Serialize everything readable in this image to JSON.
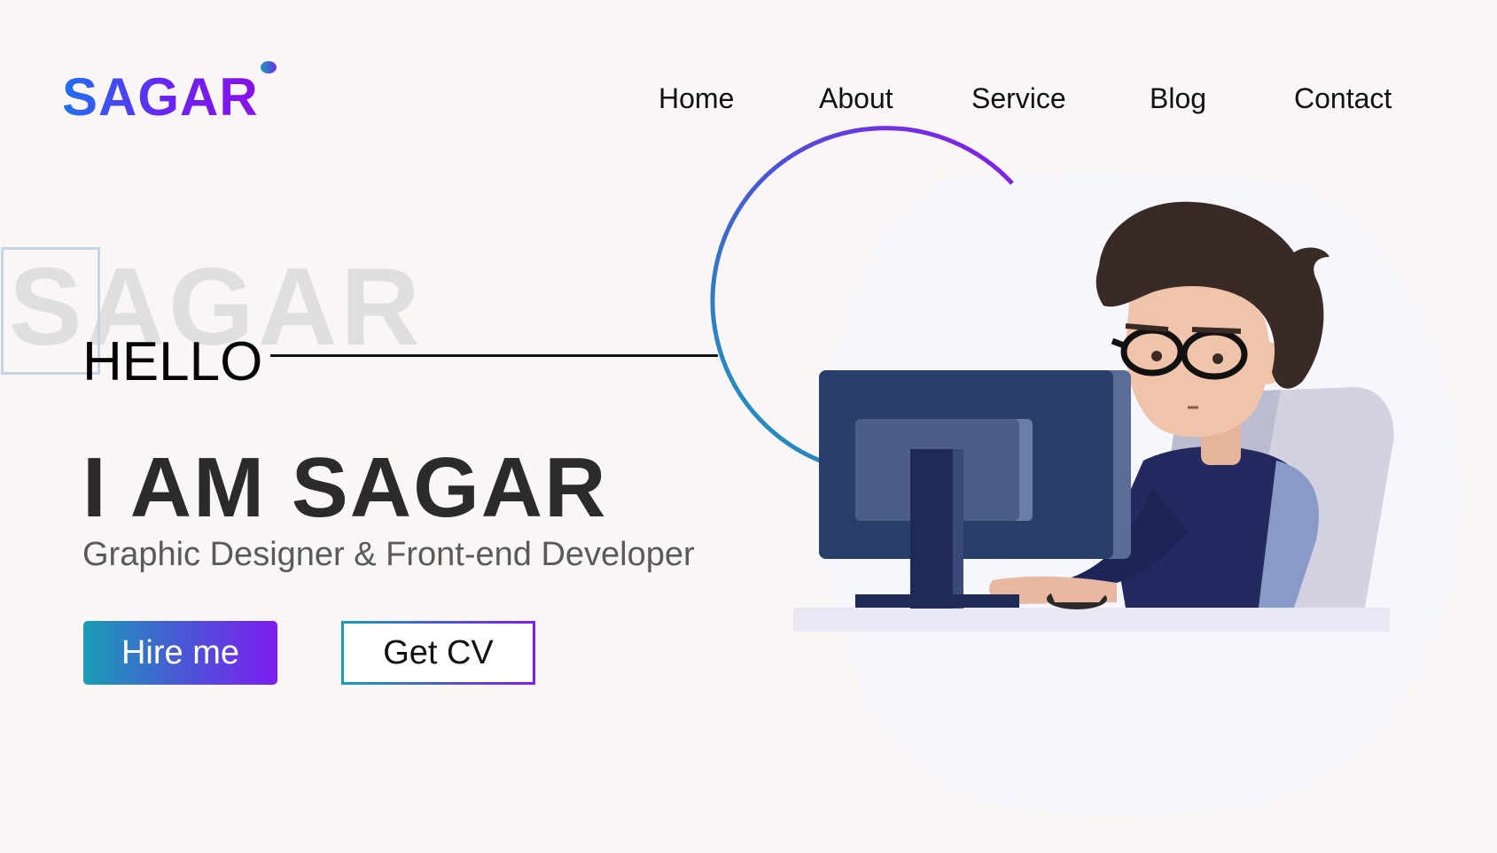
{
  "header": {
    "logo": "SAGAR",
    "nav": [
      {
        "label": "Home"
      },
      {
        "label": "About"
      },
      {
        "label": "Service"
      },
      {
        "label": "Blog"
      },
      {
        "label": "Contact"
      }
    ]
  },
  "hero": {
    "background_word": "SAGAR",
    "greeting": "HELLO",
    "title": "I AM SAGAR",
    "subtitle": "Graphic Designer & Front-end Developer",
    "hire_label": "Hire me",
    "cv_label": "Get CV"
  },
  "colors": {
    "gradient_start": "#1a9db5",
    "gradient_mid": "#4d52d8",
    "gradient_end": "#7d1df0",
    "background": "#f9f6f5",
    "title": "#2b2b2b"
  },
  "icons": {
    "illustration": "developer-at-computer-illustration"
  }
}
